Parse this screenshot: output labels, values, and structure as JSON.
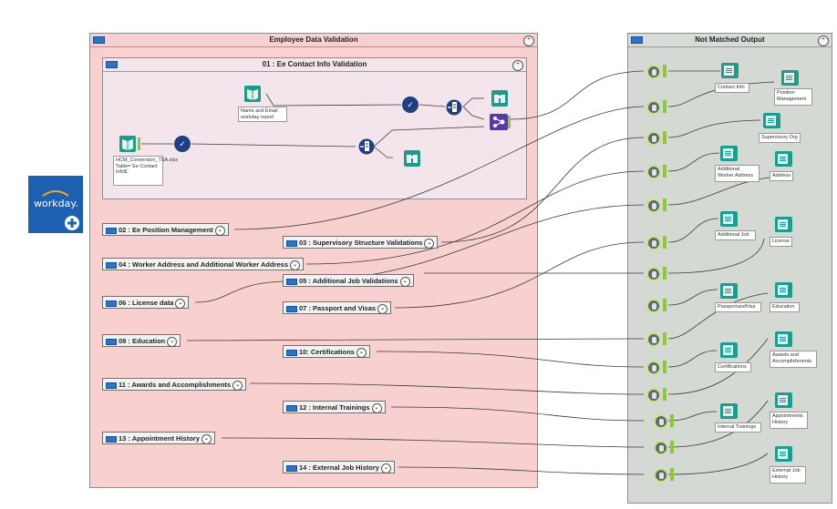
{
  "main_container": {
    "title": "Employee Data Validation"
  },
  "inner_container": {
    "title": "01 : Ee Contact Info Validation"
  },
  "output_container": {
    "title": "Not Matched Output"
  },
  "logo": {
    "text": "workday."
  },
  "annotations": {
    "name_email": "Name and Email workday report",
    "hcm": "HCM_Conversion_TSA.xlsx Table=`Ee Contact Info$`"
  },
  "boxes": [
    "02 : Ee Position Management",
    "03 : Supervisory Structure Validations",
    "04 : Worker Address and Additional Worker Address",
    "05 : Additional Job Validations",
    "06 : License data",
    "07 : Passport and Visas",
    "08 : Education",
    "10: Certifications",
    "11 : Awards and Accomplishments",
    "12 : Internal Trainings",
    "13 : Appointment History",
    "14 : External Job History"
  ],
  "outputs": [
    "Contact Info",
    "Position Management",
    "Supervisory Org",
    "Additional Worker Address",
    "Address",
    "Additional Job",
    "License",
    "PassportandVisa",
    "Education",
    "Certifications",
    "Awards and Accomplishments",
    "Internal Trainings",
    "Appointments History",
    "External Job History"
  ],
  "icons": {
    "collapse": "⌃",
    "expand": "⌄",
    "filter": "✓"
  }
}
